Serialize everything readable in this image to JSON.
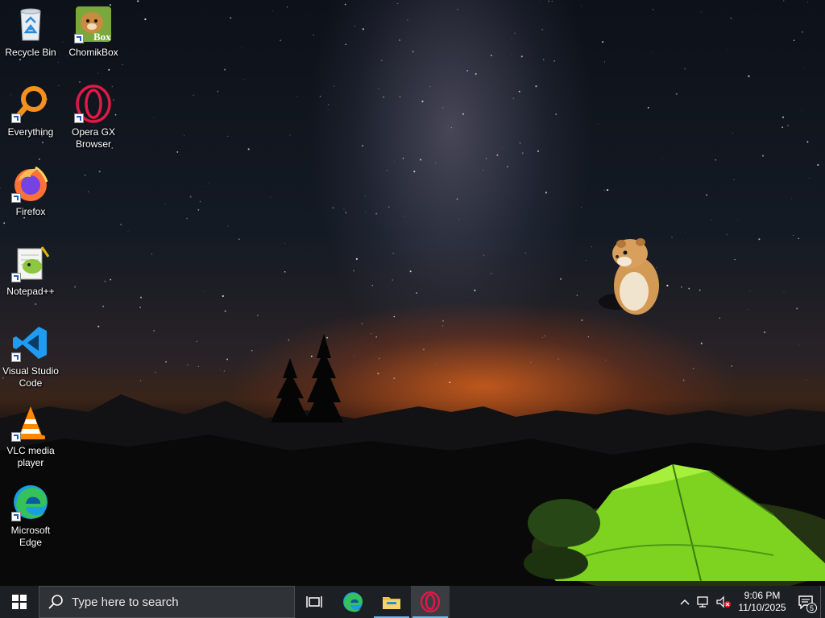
{
  "desktop": {
    "icons": [
      {
        "label": "Recycle Bin",
        "icon": "recycle-bin-icon"
      },
      {
        "label": "ChomikBox",
        "icon": "chomikbox-icon",
        "badge": "Box"
      },
      {
        "label": "Everything",
        "icon": "everything-search-icon"
      },
      {
        "label": "Opera GX\nBrowser",
        "icon": "opera-gx-icon"
      },
      {
        "label": "Firefox",
        "icon": "firefox-icon"
      },
      {
        "label": "Notepad++",
        "icon": "notepad-plus-plus-icon"
      },
      {
        "label": "Visual Studio\nCode",
        "icon": "vscode-icon"
      },
      {
        "label": "VLC media\nplayer",
        "icon": "vlc-icon"
      },
      {
        "label": "Microsoft\nEdge",
        "icon": "edge-icon"
      }
    ],
    "wallpaper": "night sky with milky way, mountains and green tent",
    "accent": "#76b9ed"
  },
  "taskbar": {
    "search_placeholder": "Type here to search",
    "apps": [
      {
        "name": "task-view",
        "icon": "task-view-icon"
      },
      {
        "name": "microsoft-edge",
        "icon": "edge-icon"
      },
      {
        "name": "file-explorer",
        "icon": "folder-icon"
      },
      {
        "name": "opera-gx",
        "icon": "opera-gx-icon",
        "active": true
      }
    ],
    "tray": {
      "time": "9:06 PM",
      "date": "11/10/2025",
      "notification_count": "5"
    }
  }
}
